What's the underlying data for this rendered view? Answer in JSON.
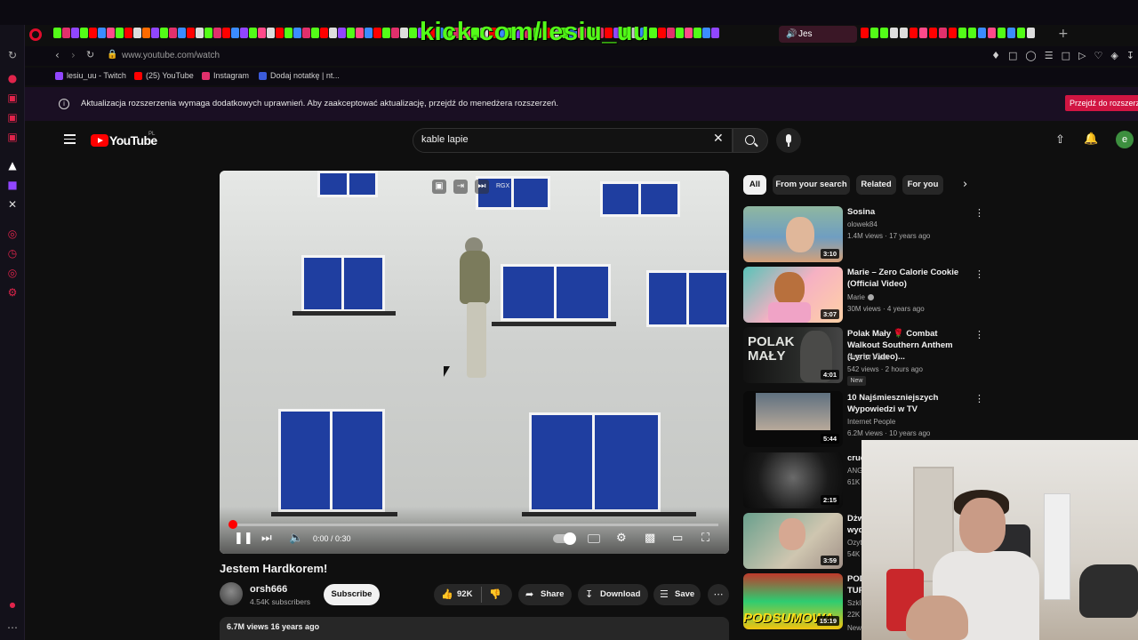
{
  "browser": {
    "overlay_text": "kick.com/lesiu_uu",
    "active_tab_label": "Jes",
    "url": "www.youtube.com/watch",
    "bookmarks": [
      {
        "label": "lesiu_uu - Twitch",
        "color": "#9146ff"
      },
      {
        "label": "(25) YouTube",
        "color": "#ff0000"
      },
      {
        "label": "Instagram",
        "color": "#e1306c"
      },
      {
        "label": "Dodaj notatkę | nt...",
        "color": "#3b5bdb"
      }
    ],
    "infobar": {
      "message": "Aktualizacja rozszerzenia wymaga dodatkowych uprawnień. Aby zaakceptować aktualizację, przejdź do menedżera rozszerzeń.",
      "action_label": "Przejdź do rozszerzeń"
    }
  },
  "youtube": {
    "logo_text": "YouTube",
    "country_code": "PL",
    "search_value": "kable lapie",
    "avatar_letter": "e"
  },
  "video": {
    "title": "Jestem Hardkorem!",
    "time": "0:00 / 0:30",
    "progress": 0,
    "channel": {
      "name": "orsh666",
      "subscribers": "4.54K subscribers"
    },
    "subscribe_label": "Subscribe",
    "likes": "92K",
    "share_label": "Share",
    "download_label": "Download",
    "save_label": "Save",
    "views_meta": "6.7M views  16 years ago",
    "overlay_label": "RGX"
  },
  "chips": [
    "All",
    "From your search",
    "Related",
    "For you"
  ],
  "recommendations": [
    {
      "title": "Sosina",
      "channel": "olowek84",
      "meta": "1.4M views · 17 years ago",
      "duration": "3:10",
      "verified": false,
      "is_new": false
    },
    {
      "title": "Marie – Zero Calorie Cookie (Official Video)",
      "channel": "Marie",
      "meta": "30M views · 4 years ago",
      "duration": "3:07",
      "verified": true,
      "is_new": false
    },
    {
      "title": "Polak Mały 🌹 Combat Walkout Southern Anthem (Lyric Video)...",
      "channel": "Riffs Of Faith",
      "meta": "542 views · 2 hours ago",
      "duration": "4:01",
      "verified": false,
      "is_new": true,
      "new_label": "New"
    },
    {
      "title": "10 Najśmieszniejszych Wypowiedzi w TV",
      "channel": "Internet People",
      "meta": "6.2M views · 10 years ago",
      "duration": "5:44",
      "verified": false,
      "is_new": false
    },
    {
      "title": "cruc",
      "channel": "ANG",
      "meta": "61K",
      "duration": "2:15"
    },
    {
      "title": "Dżw wyd",
      "channel": "Ozyt",
      "meta": "54K",
      "duration": "3:59"
    },
    {
      "title": "POD TUF",
      "channel": "Szkl",
      "meta": "22K",
      "duration": "15:19",
      "new_label": "New"
    }
  ],
  "thumb_text": {
    "polak": "POLAK MAŁY",
    "podsumowania": "PODSUMOWA"
  }
}
